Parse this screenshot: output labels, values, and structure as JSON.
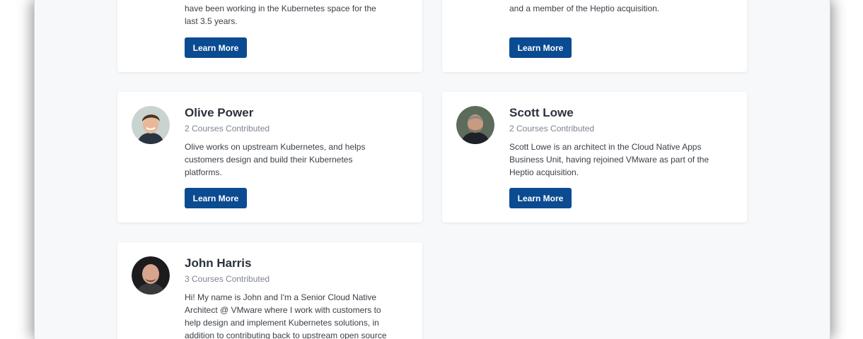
{
  "cards": [
    {
      "bio_lines": [
        "have been working in the Kubernetes space for the",
        "last 3.5 years."
      ],
      "button_label": "Learn More"
    },
    {
      "bio_lines": [
        "and a member of the Heptio acquisition."
      ],
      "button_label": "Learn More"
    },
    {
      "name": "Olive Power",
      "courses": "2 Courses Contributed",
      "bio_lines": [
        "Olive works on upstream Kubernetes, and helps",
        "customers design and build their Kubernetes",
        "platforms."
      ],
      "button_label": "Learn More"
    },
    {
      "name": "Scott Lowe",
      "courses": "2 Courses Contributed",
      "bio_lines": [
        "Scott Lowe is an architect in the Cloud Native Apps",
        "Business Unit, having rejoined VMware as part of the",
        "Heptio acquisition."
      ],
      "button_label": "Learn More"
    },
    {
      "name": "John Harris",
      "courses": "3 Courses Contributed",
      "bio_lines": [
        "Hi! My name is John and I'm a Senior Cloud Native",
        "Architect @ VMware where I work with customers to",
        "help design and implement Kubernetes solutions, in",
        "addition to contributing back to upstream open source"
      ]
    }
  ],
  "colors": {
    "button_bg": "#0b4b91",
    "name_text": "#2b313b",
    "muted_text": "#7d8590"
  }
}
